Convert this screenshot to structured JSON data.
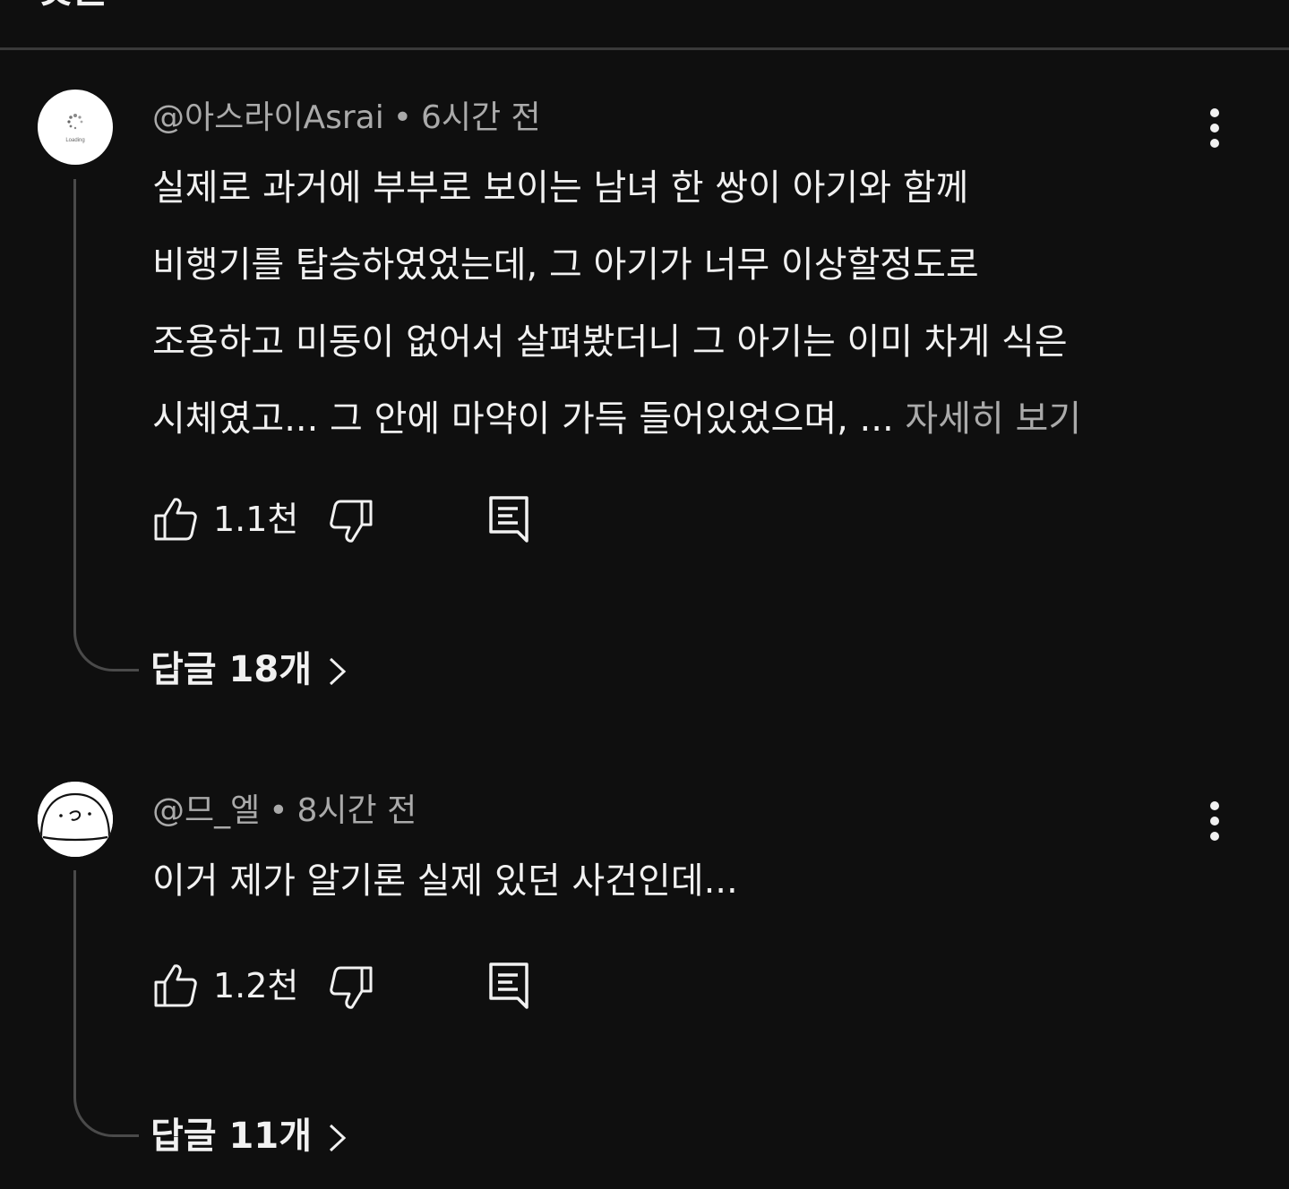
{
  "header": {
    "title_fragment": "댓글"
  },
  "comments": [
    {
      "author": "@아스라이Asrai",
      "time": "6시간 전",
      "avatar_label": "Loading",
      "lines": [
        "실제로 과거에 부부로 보이는 남녀 한 쌍이 아기와 함께",
        "비행기를 탑승하였었는데, 그 아기가 너무 이상할정도로",
        "조용하고 미동이 없어서 살펴봤더니 그 아기는 이미 차게 식은",
        "시체였고... 그 안에 마약이 가득 들어있었으며, ..."
      ],
      "more_label": "자세히 보기",
      "likes": "1.1천",
      "replies_label": "답글 18개"
    },
    {
      "author": "@므_엘",
      "time": "8시간 전",
      "lines": [
        "이거 제가 알기론 실제 있던 사건인데..."
      ],
      "likes": "1.2천",
      "replies_label": "답글 11개"
    }
  ],
  "icons": {
    "like": "thumbs-up-icon",
    "dislike": "thumbs-down-icon",
    "reply": "reply-comment-icon",
    "menu": "more-vertical-icon",
    "replies_chevron": "chevron-right-icon"
  },
  "colors": {
    "background": "#0f0f0f",
    "primary_text": "#f1f1f1",
    "secondary_text": "#aaaaaa",
    "divider": "#3a3a3a",
    "thread_line": "#4a4a4a"
  }
}
